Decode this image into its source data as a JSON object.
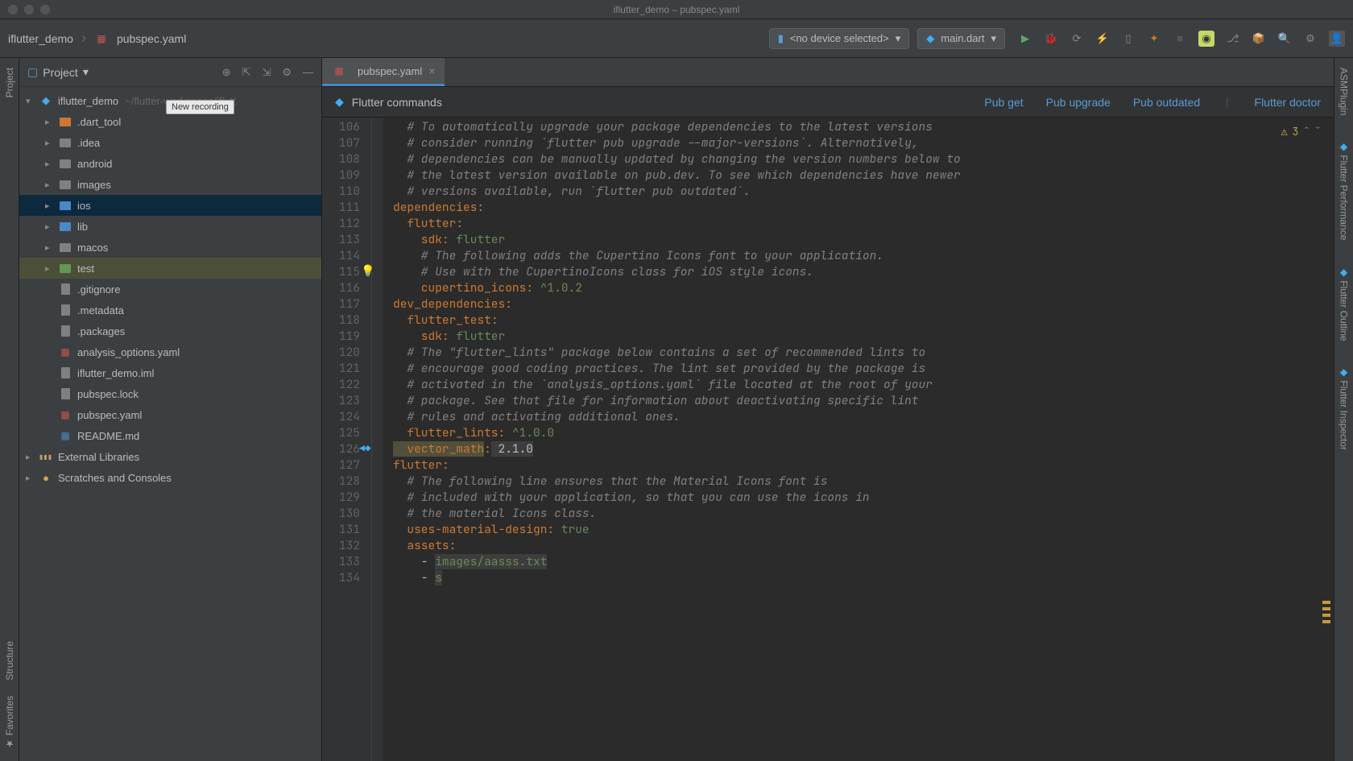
{
  "window": {
    "title": "iflutter_demo – pubspec.yaml"
  },
  "breadcrumb": {
    "project": "iflutter_demo",
    "file": "pubspec.yaml"
  },
  "tooltip": "New recording",
  "device_selector": {
    "label": "<no device selected>"
  },
  "run_config": {
    "label": "main.dart"
  },
  "sidebar": {
    "title": "Project",
    "root": {
      "name": "iflutter_demo",
      "path": "~/flutter-workspace/iflutt"
    },
    "tree": [
      {
        "name": ".dart_tool",
        "type": "folder-orange",
        "chevron": true
      },
      {
        "name": ".idea",
        "type": "folder-gray",
        "chevron": true
      },
      {
        "name": "android",
        "type": "folder-gray",
        "chevron": true
      },
      {
        "name": "images",
        "type": "folder-gray",
        "chevron": true
      },
      {
        "name": "ios",
        "type": "folder-blue",
        "chevron": true,
        "selected": true
      },
      {
        "name": "lib",
        "type": "folder-blue",
        "chevron": true
      },
      {
        "name": "macos",
        "type": "folder-gray",
        "chevron": true
      },
      {
        "name": "test",
        "type": "folder-green",
        "chevron": true,
        "highlighted": true
      },
      {
        "name": ".gitignore",
        "type": "file-gray"
      },
      {
        "name": ".metadata",
        "type": "file-gray"
      },
      {
        "name": ".packages",
        "type": "file-gray"
      },
      {
        "name": "analysis_options.yaml",
        "type": "file-yaml"
      },
      {
        "name": "iflutter_demo.iml",
        "type": "file-gray"
      },
      {
        "name": "pubspec.lock",
        "type": "file-gray"
      },
      {
        "name": "pubspec.yaml",
        "type": "file-yaml"
      },
      {
        "name": "README.md",
        "type": "file-md"
      }
    ],
    "external_libs": "External Libraries",
    "scratches": "Scratches and Consoles"
  },
  "tab": {
    "name": "pubspec.yaml"
  },
  "flutter_bar": {
    "title": "Flutter commands",
    "actions": [
      "Pub get",
      "Pub upgrade",
      "Pub outdated"
    ],
    "doctor": "Flutter doctor"
  },
  "warnings": {
    "count": "3"
  },
  "code": {
    "first_line": 106,
    "lines": [
      {
        "t": "comment",
        "text": "  # To automatically upgrade your package dependencies to the latest versions"
      },
      {
        "t": "comment",
        "text": "  # consider running `flutter pub upgrade --major-versions`. Alternatively,"
      },
      {
        "t": "comment",
        "text": "  # dependencies can be manually updated by changing the version numbers below to"
      },
      {
        "t": "comment",
        "text": "  # the latest version available on pub.dev. To see which dependencies have newer"
      },
      {
        "t": "comment",
        "text": "  # versions available, run `flutter pub outdated`."
      },
      {
        "t": "kv",
        "key": "dependencies",
        "val": ""
      },
      {
        "t": "kv",
        "key": "  flutter",
        "val": ""
      },
      {
        "t": "kv",
        "key": "    sdk",
        "val": " flutter"
      },
      {
        "t": "comment",
        "text": "    # The following adds the Cupertino Icons font to your application."
      },
      {
        "t": "comment",
        "text": "    # Use with the CupertinoIcons class for iOS style icons."
      },
      {
        "t": "kv",
        "key": "    cupertino_icons",
        "val": " ^1.0.2"
      },
      {
        "t": "kv",
        "key": "dev_dependencies",
        "val": ""
      },
      {
        "t": "kv",
        "key": "  flutter_test",
        "val": ""
      },
      {
        "t": "kv",
        "key": "    sdk",
        "val": " flutter"
      },
      {
        "t": "comment",
        "text": "  # The \"flutter_lints\" package below contains a set of recommended lints to"
      },
      {
        "t": "comment",
        "text": "  # encourage good coding practices. The lint set provided by the package is"
      },
      {
        "t": "comment",
        "text": "  # activated in the `analysis_options.yaml` file located at the root of your"
      },
      {
        "t": "comment",
        "text": "  # package. See that file for information about deactivating specific lint"
      },
      {
        "t": "comment",
        "text": "  # rules and activating additional ones."
      },
      {
        "t": "kv",
        "key": "  flutter_lints",
        "val": " ^1.0.0"
      },
      {
        "t": "kvh",
        "key": "  vector_math",
        "val": " 2.1.0"
      },
      {
        "t": "kv",
        "key": "flutter",
        "val": ""
      },
      {
        "t": "comment",
        "text": "  # The following line ensures that the Material Icons font is"
      },
      {
        "t": "comment",
        "text": "  # included with your application, so that you can use the icons in"
      },
      {
        "t": "comment",
        "text": "  # the material Icons class."
      },
      {
        "t": "kv",
        "key": "  uses-material-design",
        "val": " true"
      },
      {
        "t": "kv",
        "key": "  assets",
        "val": ""
      },
      {
        "t": "list",
        "text": "    - ",
        "val": "images/aasss.txt"
      },
      {
        "t": "list",
        "text": "    - ",
        "val": "s"
      }
    ]
  },
  "left_tabs": [
    "Project",
    "Structure",
    "Favorites"
  ],
  "right_tabs": [
    "ASMPlugin",
    "Flutter Performance",
    "Flutter Outline",
    "Flutter Inspector"
  ]
}
